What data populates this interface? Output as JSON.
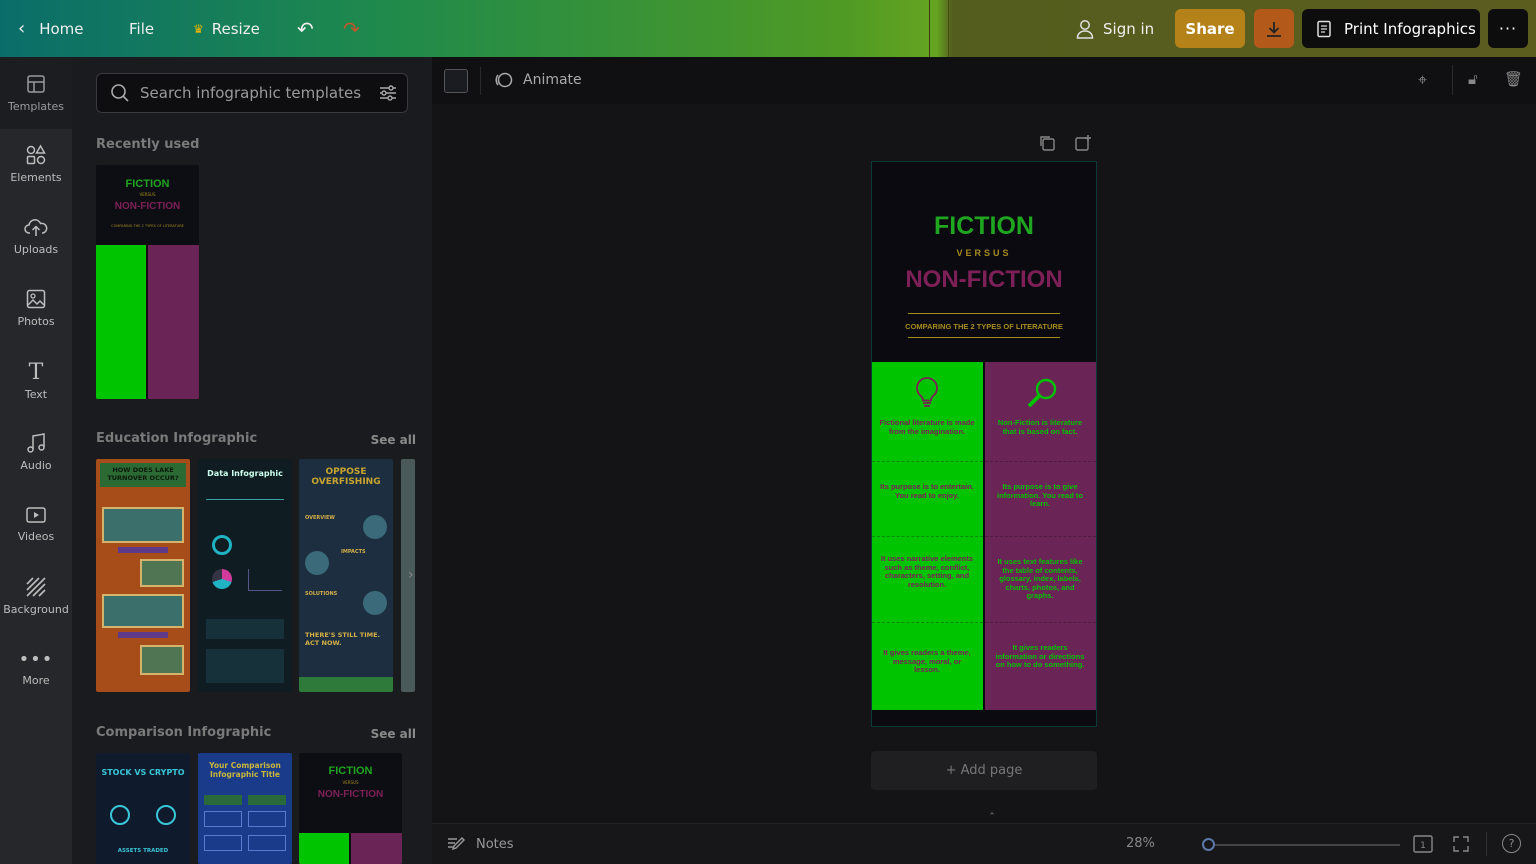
{
  "topbar": {
    "home": "Home",
    "file": "File",
    "resize": "Resize",
    "sign_in": "Sign in",
    "share": "Share",
    "print": "Print Infographics"
  },
  "rail": {
    "items": [
      {
        "label": "Templates"
      },
      {
        "label": "Elements"
      },
      {
        "label": "Uploads"
      },
      {
        "label": "Photos"
      },
      {
        "label": "Text"
      },
      {
        "label": "Audio"
      },
      {
        "label": "Videos"
      },
      {
        "label": "Background"
      },
      {
        "label": "More"
      }
    ]
  },
  "panel": {
    "search_placeholder": "Search infographic templates",
    "recently_used": "Recently used",
    "education_title": "Education Infographic",
    "comparison_title": "Comparison Infographic",
    "see_all": "See all"
  },
  "thumbs": {
    "recent_fiction": "FICTION",
    "recent_versus": "VERSUS",
    "recent_nonfiction": "NON-FICTION",
    "recent_sub": "COMPARING THE 2 TYPES OF LITERATURE",
    "edu1_title": "HOW DOES LAKE TURNOVER OCCUR?",
    "edu2_title": "Data Infographic",
    "edu3_title": "OPPOSE OVERFISHING",
    "edu3_h1": "OVERVIEW",
    "edu3_h2": "IMPACTS",
    "edu3_h3": "SOLUTIONS",
    "edu3_cta": "THERE'S STILL TIME. ACT NOW.",
    "cmp1_title": "STOCK VS CRYPTO",
    "cmp1_sub": "ASSETS TRADED",
    "cmp2_title": "Your Comparison Infographic Title",
    "cmp3_fiction": "FICTION",
    "cmp3_versus": "VERSUS",
    "cmp3_nonfiction": "NON-FICTION"
  },
  "ctx": {
    "animate": "Animate",
    "color": "#1b1b22"
  },
  "page": {
    "fiction": "FICTION",
    "versus": "VERSUS",
    "nonfiction": "NON-FICTION",
    "subtitle": "COMPARING THE 2 TYPES OF LITERATURE",
    "left": [
      "Fictional literature is made from the imagination.",
      "Its purpose is to entertain. You read to enjoy.",
      "It uses narrative elements such as theme, conflict, characters, setting, and resolution.",
      "It gives readers a theme, message, moral, or lesson."
    ],
    "right": [
      "Non-Fiction is literature that is based on fact.",
      "Its purpose is to give information. You read to learn.",
      "It uses text features like the table of contents, glossary, index, labels, charts, photos, and graphs.",
      "It gives readers information or directions on how to do something."
    ],
    "add_page": "+ Add page"
  },
  "bottom": {
    "notes": "Notes",
    "zoom": "28%",
    "zoom_fraction": 0.0
  },
  "colors": {
    "green": "#00c400",
    "magenta": "#6b2456",
    "fiction_text": "#1fa51f",
    "nonfiction_text": "#7d2057",
    "gold": "#a68b1e",
    "share_bg": "#b5821a",
    "download_bg": "#b35a1b"
  }
}
